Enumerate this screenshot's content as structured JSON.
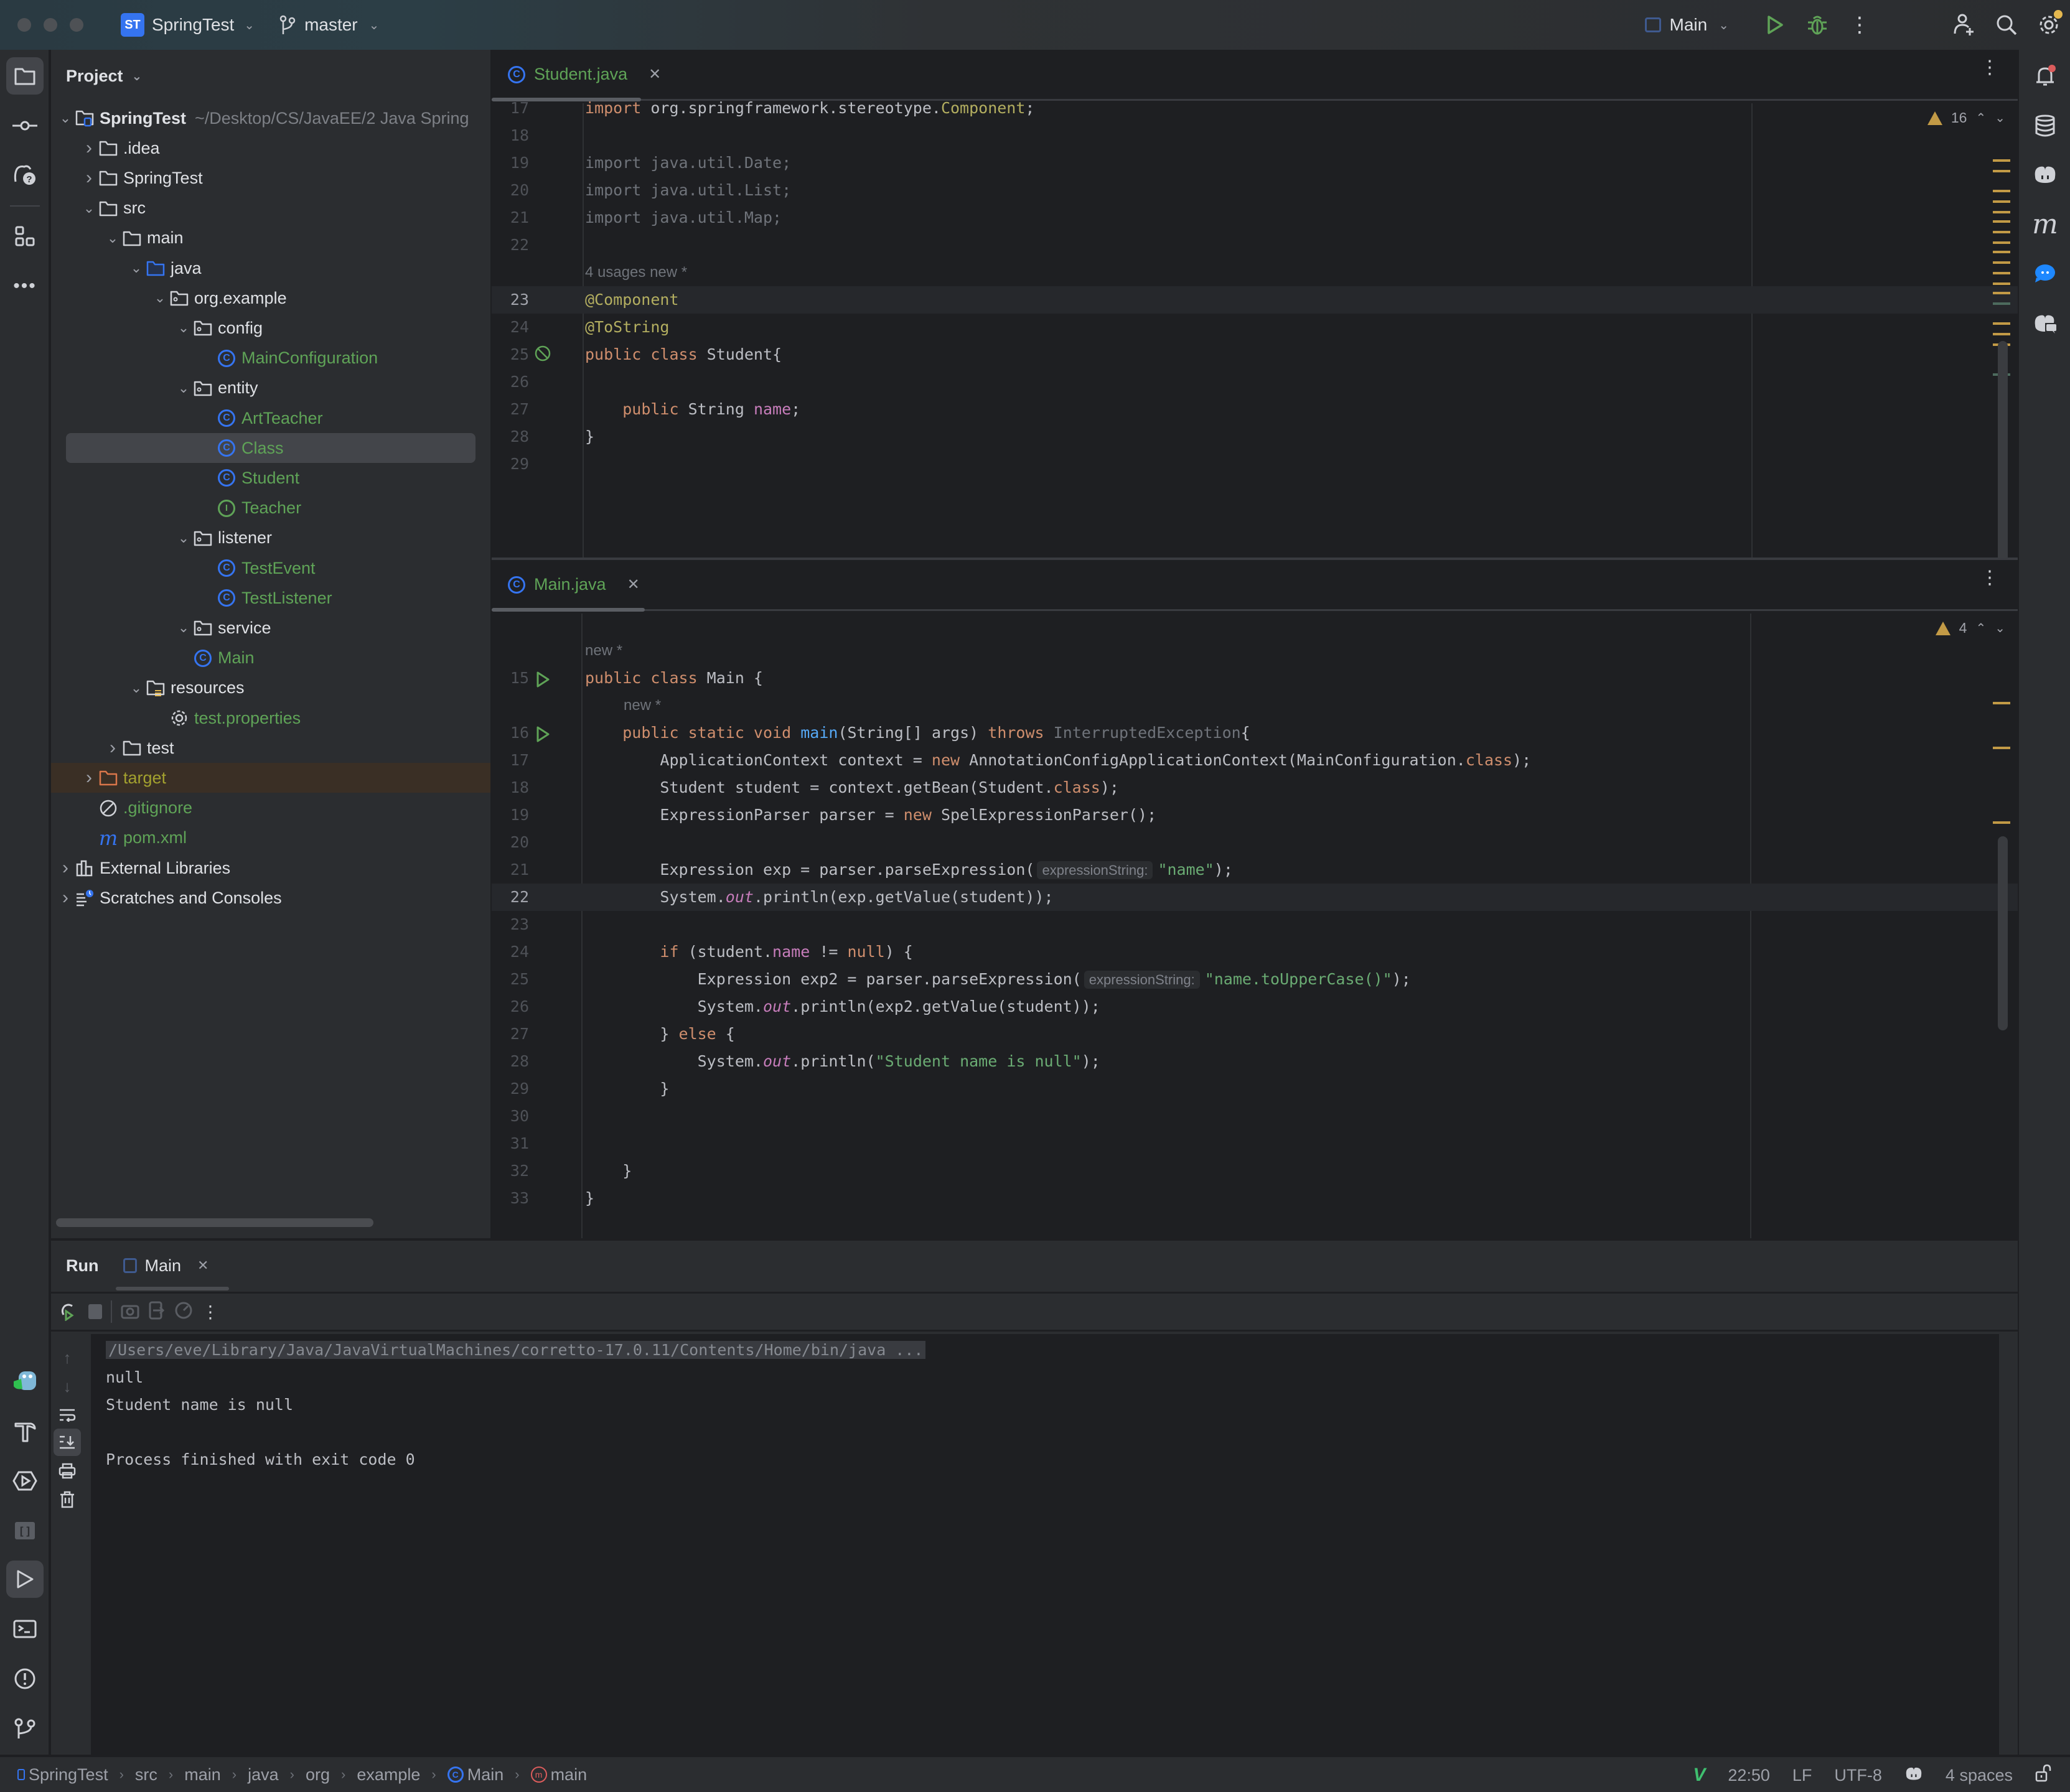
{
  "titlebar": {
    "project_initials": "ST",
    "project_name": "SpringTest",
    "branch": "master",
    "run_config": "Main"
  },
  "project_panel": {
    "title": "Project",
    "tree": [
      {
        "label": "SpringTest",
        "path": "~/Desktop/CS/JavaEE/2 Java Spring",
        "depth": 0,
        "expanded": true,
        "icon": "module-folder-icon",
        "style": "bold"
      },
      {
        "label": ".idea",
        "depth": 1,
        "expanded": false,
        "icon": "folder-icon"
      },
      {
        "label": "SpringTest",
        "depth": 1,
        "expanded": false,
        "icon": "folder-icon"
      },
      {
        "label": "src",
        "depth": 1,
        "expanded": true,
        "icon": "folder-icon"
      },
      {
        "label": "main",
        "depth": 2,
        "expanded": true,
        "icon": "folder-icon"
      },
      {
        "label": "java",
        "depth": 3,
        "expanded": true,
        "icon": "source-folder-icon"
      },
      {
        "label": "org.example",
        "depth": 4,
        "expanded": true,
        "icon": "package-icon"
      },
      {
        "label": "config",
        "depth": 5,
        "expanded": true,
        "icon": "package-icon"
      },
      {
        "label": "MainConfiguration",
        "depth": 6,
        "icon": "class-icon",
        "style": "green"
      },
      {
        "label": "entity",
        "depth": 5,
        "expanded": true,
        "icon": "package-icon"
      },
      {
        "label": "ArtTeacher",
        "depth": 6,
        "icon": "class-icon",
        "style": "green"
      },
      {
        "label": "Class",
        "depth": 6,
        "icon": "class-icon",
        "style": "green",
        "selected": true
      },
      {
        "label": "Student",
        "depth": 6,
        "icon": "class-icon",
        "style": "green"
      },
      {
        "label": "Teacher",
        "depth": 6,
        "icon": "interface-icon",
        "style": "green"
      },
      {
        "label": "listener",
        "depth": 5,
        "expanded": true,
        "icon": "package-icon"
      },
      {
        "label": "TestEvent",
        "depth": 6,
        "icon": "class-icon",
        "style": "green"
      },
      {
        "label": "TestListener",
        "depth": 6,
        "icon": "class-icon",
        "style": "green"
      },
      {
        "label": "service",
        "depth": 5,
        "expanded": true,
        "icon": "package-icon"
      },
      {
        "label": "Main",
        "depth": 5,
        "icon": "class-icon",
        "style": "green"
      },
      {
        "label": "resources",
        "depth": 3,
        "expanded": true,
        "icon": "resources-folder-icon"
      },
      {
        "label": "test.properties",
        "depth": 4,
        "icon": "properties-icon",
        "style": "green"
      },
      {
        "label": "test",
        "depth": 2,
        "expanded": false,
        "icon": "folder-icon"
      },
      {
        "label": "target",
        "depth": 1,
        "expanded": false,
        "icon": "excluded-folder-icon",
        "style": "olive",
        "excluded": true
      },
      {
        "label": ".gitignore",
        "depth": 1,
        "icon": "ignore-file-icon",
        "style": "green"
      },
      {
        "label": "pom.xml",
        "depth": 1,
        "icon": "maven-icon",
        "style": "green"
      },
      {
        "label": "External Libraries",
        "depth": 0,
        "expanded": false,
        "icon": "libraries-icon"
      },
      {
        "label": "Scratches and Consoles",
        "depth": 0,
        "expanded": false,
        "icon": "scratches-icon"
      }
    ]
  },
  "editor_top": {
    "tab_label": "Student.java",
    "warnings": "16",
    "code_vision": "4 usages   new *",
    "lines": [
      {
        "n": "17",
        "html": "<span class=\"kw\">import</span> org.springframework.stereotype.<span class=\"ann\">Component</span>;"
      },
      {
        "n": "18",
        "html": ""
      },
      {
        "n": "19",
        "html": "<span class=\"dim\">import java.util.Date;</span>"
      },
      {
        "n": "20",
        "html": "<span class=\"dim\">import java.util.List;</span>"
      },
      {
        "n": "21",
        "html": "<span class=\"dim\">import java.util.Map;</span>"
      },
      {
        "n": "22",
        "html": ""
      },
      {
        "n": "23",
        "html": "<span class=\"ann\">@Component</span>",
        "current": true
      },
      {
        "n": "24",
        "html": "<span class=\"ann\">@ToString</span>"
      },
      {
        "n": "25",
        "html": "<span class=\"kw\">public class</span> Student{"
      },
      {
        "n": "26",
        "html": ""
      },
      {
        "n": "27",
        "html": "    <span class=\"kw\">public</span> String <span class=\"fld\">name</span>;"
      },
      {
        "n": "28",
        "html": "}"
      },
      {
        "n": "29",
        "html": ""
      }
    ]
  },
  "editor_bottom": {
    "tab_label": "Main.java",
    "warnings": "4",
    "hint_new": "new *",
    "inlay_param": "expressionString:",
    "lines": [
      {
        "n": "15",
        "html": "<span class=\"kw\">public class</span> Main {",
        "run": true
      },
      {
        "n": "16",
        "html": "    <span class=\"kw\">public static void</span> <span class=\"fn\">main</span>(String[] args) <span class=\"kw\">throws</span> <span class=\"dim\">InterruptedException</span>{",
        "run": true
      },
      {
        "n": "17",
        "html": "        ApplicationContext context = <span class=\"kw\">new</span> AnnotationConfigApplicationContext(MainConfiguration.<span class=\"kw\">class</span>);"
      },
      {
        "n": "18",
        "html": "        Student student = context.getBean(Student.<span class=\"kw\">class</span>);"
      },
      {
        "n": "19",
        "html": "        ExpressionParser parser = <span class=\"kw\">new</span> SpelExpressionParser();"
      },
      {
        "n": "20",
        "html": ""
      },
      {
        "n": "21",
        "html": "        Expression exp = parser.parseExpression(<span class=\"inlay\">expressionString:</span><span class=\"str\">\"name\"</span>);"
      },
      {
        "n": "22",
        "html": "        System.<span class=\"sout\">out</span>.println(exp.getValue(student));",
        "current": true
      },
      {
        "n": "23",
        "html": ""
      },
      {
        "n": "24",
        "html": "        <span class=\"kw\">if</span> (student.<span class=\"fld\">name</span> != <span class=\"kw\">null</span>) {"
      },
      {
        "n": "25",
        "html": "            Expression exp2 = parser.parseExpression(<span class=\"inlay\">expressionString:</span><span class=\"str\">\"name.toUpperCase()\"</span>);"
      },
      {
        "n": "26",
        "html": "            System.<span class=\"sout\">out</span>.println(exp2.getValue(student));"
      },
      {
        "n": "27",
        "html": "        } <span class=\"kw\">else</span> {"
      },
      {
        "n": "28",
        "html": "            System.<span class=\"sout\">out</span>.println(<span class=\"str\">\"Student name is null\"</span>);"
      },
      {
        "n": "29",
        "html": "        }"
      },
      {
        "n": "30",
        "html": ""
      },
      {
        "n": "31",
        "html": ""
      },
      {
        "n": "32",
        "html": "    }"
      },
      {
        "n": "33",
        "html": "}"
      }
    ]
  },
  "run_panel": {
    "title": "Run",
    "tab_label": "Main",
    "console": [
      "/Users/eve/Library/Java/JavaVirtualMachines/corretto-17.0.11/Contents/Home/bin/java ...",
      "null",
      "Student name is null",
      "",
      "Process finished with exit code 0"
    ]
  },
  "statusbar": {
    "breadcrumbs": [
      "SpringTest",
      "src",
      "main",
      "java",
      "org",
      "example",
      "Main",
      "main"
    ],
    "cursor": "22:50",
    "line_sep": "LF",
    "encoding": "UTF-8",
    "indent": "4 spaces"
  },
  "colors": {
    "accent": "#3574f0",
    "green_file": "#5fa357",
    "warning": "#c29a46",
    "keyword": "#cf8e6d",
    "string": "#6aab73",
    "field": "#c77dbb"
  }
}
